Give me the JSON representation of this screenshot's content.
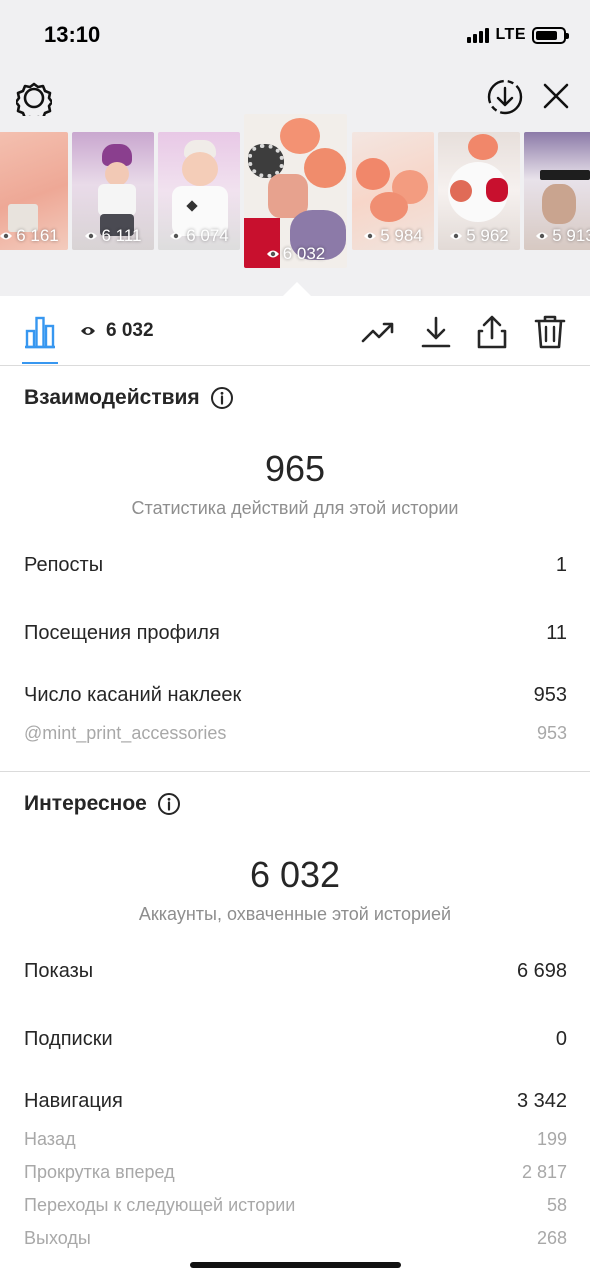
{
  "status_bar": {
    "time": "13:10",
    "network": "LTE"
  },
  "thumbnails": [
    {
      "views": "6 161"
    },
    {
      "views": "6 111"
    },
    {
      "views": "6 074"
    },
    {
      "views": "6 032",
      "selected": true
    },
    {
      "views": "5 984"
    },
    {
      "views": "5 962"
    },
    {
      "views": "5 913"
    }
  ],
  "toolbar": {
    "views_total": "6 032"
  },
  "interactions": {
    "title": "Взаимодействия",
    "total": "965",
    "caption": "Статистика действий для этой истории",
    "rows": [
      {
        "label": "Репосты",
        "value": "1"
      },
      {
        "label": "Посещения профиля",
        "value": "11"
      },
      {
        "label": "Число касаний наклеек",
        "value": "953"
      }
    ],
    "sub_rows": [
      {
        "label": "@mint_print_accessories",
        "value": "953"
      }
    ]
  },
  "discovery": {
    "title": "Интересное",
    "total": "6 032",
    "caption": "Аккаунты, охваченные этой историей",
    "rows": [
      {
        "label": "Показы",
        "value": "6 698"
      },
      {
        "label": "Подписки",
        "value": "0"
      },
      {
        "label": "Навигация",
        "value": "3 342"
      }
    ],
    "sub_rows": [
      {
        "label": "Назад",
        "value": "199"
      },
      {
        "label": "Прокрутка вперед",
        "value": "2 817"
      },
      {
        "label": "Переходы к следующей истории",
        "value": "58"
      },
      {
        "label": "Выходы",
        "value": "268"
      }
    ]
  },
  "colors": {
    "accent": "#3797f0",
    "text": "#262626",
    "muted": "#8e8e8e",
    "top_bg": "#f0f0f2"
  },
  "icons": {
    "settings": "gear-icon",
    "save": "download-circle-icon",
    "close": "close-icon",
    "insights_tab": "bar-chart-icon",
    "views": "eye-icon",
    "promote": "trending-up-icon",
    "download": "download-icon",
    "share": "share-icon",
    "delete": "trash-icon",
    "info": "info-icon"
  }
}
